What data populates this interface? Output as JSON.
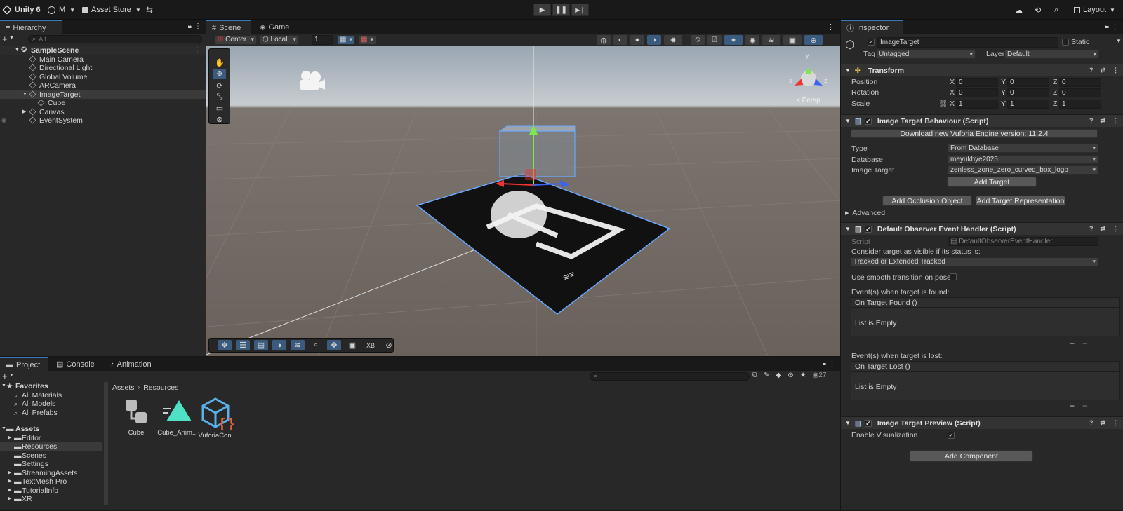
{
  "toolbar": {
    "app": "Unity 6",
    "account": "M",
    "asset_store": "Asset Store",
    "layout": "Layout"
  },
  "hierarchy": {
    "tab": "Hierarchy",
    "search_placeholder": "All",
    "scene": "SampleScene",
    "items": [
      {
        "label": "Main Camera"
      },
      {
        "label": "Directional Light"
      },
      {
        "label": "Global Volume"
      },
      {
        "label": "ARCamera"
      },
      {
        "label": "ImageTarget"
      },
      {
        "label": "Cube"
      },
      {
        "label": "Canvas"
      },
      {
        "label": "EventSystem"
      }
    ]
  },
  "scene": {
    "tabs": [
      "Scene",
      "Game"
    ],
    "pivot": "Center",
    "space": "Local",
    "snap_value": "1",
    "persp": "< Persp",
    "bottom_xb": "XB"
  },
  "inspector": {
    "tab": "Inspector",
    "object_name": "ImageTarget",
    "static": "Static",
    "tag_label": "Tag",
    "tag": "Untagged",
    "layer_label": "Layer",
    "layer": "Default",
    "transform": {
      "title": "Transform",
      "position": {
        "label": "Position",
        "x": "0",
        "y": "0",
        "z": "0"
      },
      "rotation": {
        "label": "Rotation",
        "x": "0",
        "y": "0",
        "z": "0"
      },
      "scale": {
        "label": "Scale",
        "x": "1",
        "y": "1",
        "z": "1"
      }
    },
    "itb": {
      "title": "Image Target Behaviour (Script)",
      "download_button": "Download new Vuforia Engine version: 11.2.4",
      "type_label": "Type",
      "type": "From Database",
      "database_label": "Database",
      "database": "meyukhye2025",
      "image_target_label": "Image Target",
      "image_target": "zenless_zone_zero_curved_box_logo",
      "add_target": "Add Target",
      "add_occlusion": "Add Occlusion Object",
      "add_representation": "Add Target Representation",
      "advanced": "Advanced"
    },
    "doeh": {
      "title": "Default Observer Event Handler (Script)",
      "script_label": "Script",
      "script": "DefaultObserverEventHandler",
      "visible_label": "Consider target as visible if its status is:",
      "visible_value": "Tracked or Extended Tracked",
      "smooth_label": "Use smooth transition on pose",
      "found_label": "Event(s) when target is found:",
      "found_event": "On Target Found ()",
      "lost_label": "Event(s) when target is lost:",
      "lost_event": "On Target Lost ()",
      "empty": "List is Empty"
    },
    "itp": {
      "title": "Image Target Preview (Script)",
      "enable_label": "Enable Visualization"
    },
    "add_component": "Add Component"
  },
  "project": {
    "tabs": [
      "Project",
      "Console",
      "Animation"
    ],
    "count": "27",
    "favorites": "Favorites",
    "favorite_items": [
      "All Materials",
      "All Models",
      "All Prefabs"
    ],
    "assets": "Assets",
    "folders": [
      "Editor",
      "Resources",
      "Scenes",
      "Settings",
      "StreamingAssets",
      "TextMesh Pro",
      "TutorialInfo",
      "XR"
    ],
    "breadcrumb": [
      "Assets",
      "Resources"
    ],
    "items": [
      {
        "label": "Cube",
        "icon": "prefab-icon"
      },
      {
        "label": "Cube_Anim...",
        "icon": "animation-icon"
      },
      {
        "label": "VuforiaCon...",
        "icon": "script-asset-icon"
      }
    ]
  },
  "colors": {
    "accent": "#3a79bb",
    "selection": "#2c5d87"
  }
}
